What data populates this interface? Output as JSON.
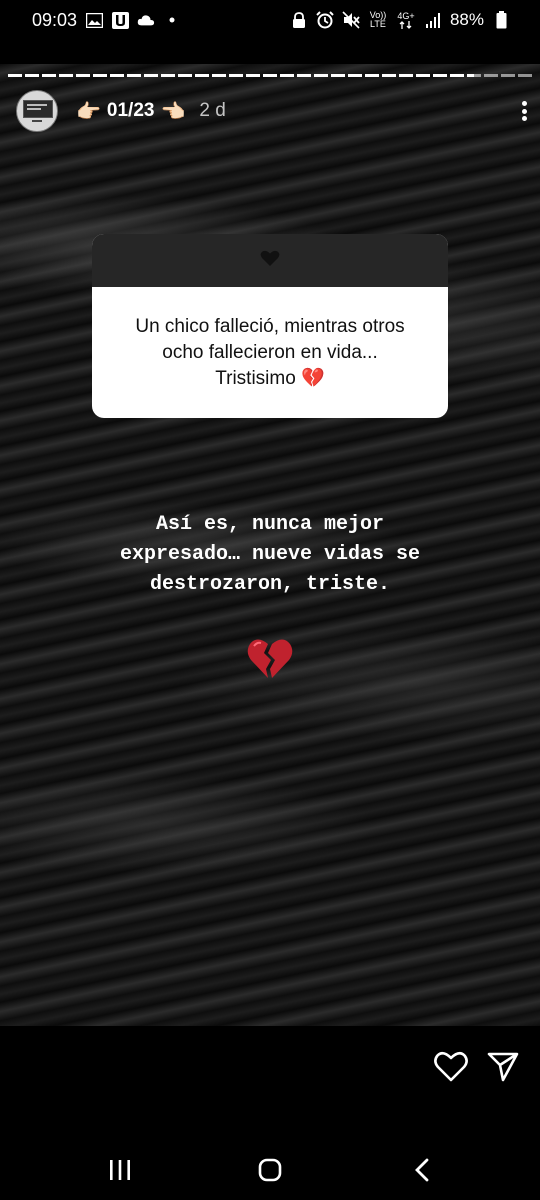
{
  "status_bar": {
    "time": "09:03",
    "left_icons": [
      "image-icon",
      "u-app-icon",
      "cloud-icon",
      "dot-icon"
    ],
    "right_icons": [
      "lock-icon",
      "alarm-icon",
      "mute-icon",
      "volte-icon",
      "4g-icon",
      "signal-icon",
      "battery-icon"
    ],
    "volte_label_top": "Vo))",
    "volte_label_bottom": "LTE",
    "network_label_top": "4G+",
    "battery_percent": "88%"
  },
  "story": {
    "progress_fraction": 0.89,
    "header": {
      "hand_left": "👉🏻",
      "username": "01/23",
      "hand_right": "👈🏻",
      "time_ago": "2 d"
    },
    "question_box": {
      "icon": "heart-icon",
      "text": "Un chico falleció, mientras otros\nocho fallecieron en vida...\nTristisimo 💔"
    },
    "reply_text": "Así es, nunca mejor\nexpresado… nueve vidas se\ndestrozaron, triste.",
    "sticker": "broken-heart-icon"
  },
  "actions": {
    "like_icon": "heart-outline-icon",
    "share_icon": "send-icon"
  },
  "nav": {
    "recents_icon": "recents-icon",
    "home_icon": "home-icon",
    "back_icon": "back-icon"
  }
}
